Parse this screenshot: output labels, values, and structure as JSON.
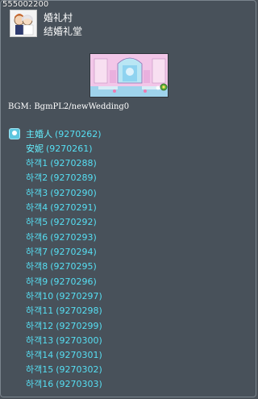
{
  "map": {
    "id": "555002200",
    "region": "婚礼村",
    "name": "结婚礼堂",
    "bgm_label": "BGM:",
    "bgm_value": "BgmPL2/newWedding0"
  },
  "npcs": [
    {
      "name": "主婚人",
      "id": "(9270262)"
    },
    {
      "name": "安妮",
      "id": "(9270261)"
    },
    {
      "name": "하객1",
      "id": "(9270288)"
    },
    {
      "name": "하객2",
      "id": "(9270289)"
    },
    {
      "name": "하객3",
      "id": "(9270290)"
    },
    {
      "name": "하객4",
      "id": "(9270291)"
    },
    {
      "name": "하객5",
      "id": "(9270292)"
    },
    {
      "name": "하객6",
      "id": "(9270293)"
    },
    {
      "name": "하객7",
      "id": "(9270294)"
    },
    {
      "name": "하객8",
      "id": "(9270295)"
    },
    {
      "name": "하객9",
      "id": "(9270296)"
    },
    {
      "name": "하객10",
      "id": "(9270297)"
    },
    {
      "name": "하객11",
      "id": "(9270298)"
    },
    {
      "name": "하객12",
      "id": "(9270299)"
    },
    {
      "name": "하객13",
      "id": "(9270300)"
    },
    {
      "name": "하객14",
      "id": "(9270301)"
    },
    {
      "name": "하객15",
      "id": "(9270302)"
    },
    {
      "name": "하객16",
      "id": "(9270303)"
    }
  ],
  "icons": {
    "map_icon": "wedding-couple-icon",
    "npc_icon": "npc-marker-icon",
    "preview": "chapel-preview-image"
  },
  "colors": {
    "background": "#48515a",
    "npc_text": "#56dff3",
    "white_text": "#ffffff"
  }
}
